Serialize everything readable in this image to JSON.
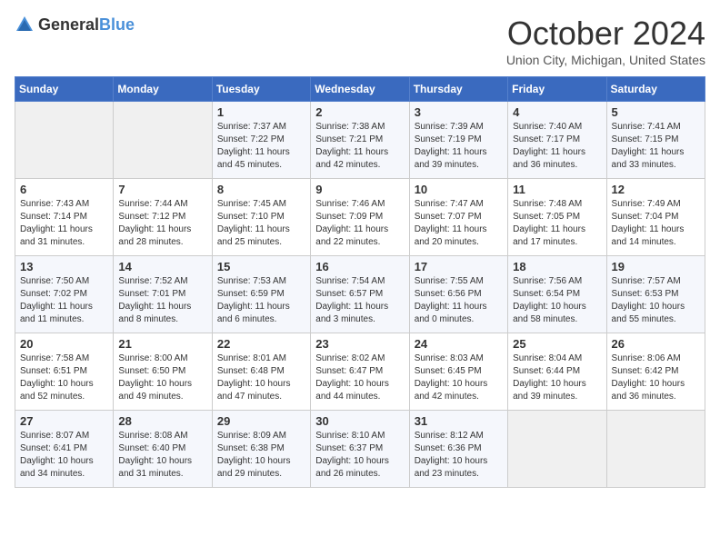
{
  "header": {
    "logo_general": "General",
    "logo_blue": "Blue",
    "title": "October 2024",
    "location": "Union City, Michigan, United States"
  },
  "days_of_week": [
    "Sunday",
    "Monday",
    "Tuesday",
    "Wednesday",
    "Thursday",
    "Friday",
    "Saturday"
  ],
  "weeks": [
    [
      {
        "day": "",
        "sunrise": "",
        "sunset": "",
        "daylight": "",
        "empty": true
      },
      {
        "day": "",
        "sunrise": "",
        "sunset": "",
        "daylight": "",
        "empty": true
      },
      {
        "day": "1",
        "sunrise": "Sunrise: 7:37 AM",
        "sunset": "Sunset: 7:22 PM",
        "daylight": "Daylight: 11 hours and 45 minutes."
      },
      {
        "day": "2",
        "sunrise": "Sunrise: 7:38 AM",
        "sunset": "Sunset: 7:21 PM",
        "daylight": "Daylight: 11 hours and 42 minutes."
      },
      {
        "day": "3",
        "sunrise": "Sunrise: 7:39 AM",
        "sunset": "Sunset: 7:19 PM",
        "daylight": "Daylight: 11 hours and 39 minutes."
      },
      {
        "day": "4",
        "sunrise": "Sunrise: 7:40 AM",
        "sunset": "Sunset: 7:17 PM",
        "daylight": "Daylight: 11 hours and 36 minutes."
      },
      {
        "day": "5",
        "sunrise": "Sunrise: 7:41 AM",
        "sunset": "Sunset: 7:15 PM",
        "daylight": "Daylight: 11 hours and 33 minutes."
      }
    ],
    [
      {
        "day": "6",
        "sunrise": "Sunrise: 7:43 AM",
        "sunset": "Sunset: 7:14 PM",
        "daylight": "Daylight: 11 hours and 31 minutes."
      },
      {
        "day": "7",
        "sunrise": "Sunrise: 7:44 AM",
        "sunset": "Sunset: 7:12 PM",
        "daylight": "Daylight: 11 hours and 28 minutes."
      },
      {
        "day": "8",
        "sunrise": "Sunrise: 7:45 AM",
        "sunset": "Sunset: 7:10 PM",
        "daylight": "Daylight: 11 hours and 25 minutes."
      },
      {
        "day": "9",
        "sunrise": "Sunrise: 7:46 AM",
        "sunset": "Sunset: 7:09 PM",
        "daylight": "Daylight: 11 hours and 22 minutes."
      },
      {
        "day": "10",
        "sunrise": "Sunrise: 7:47 AM",
        "sunset": "Sunset: 7:07 PM",
        "daylight": "Daylight: 11 hours and 20 minutes."
      },
      {
        "day": "11",
        "sunrise": "Sunrise: 7:48 AM",
        "sunset": "Sunset: 7:05 PM",
        "daylight": "Daylight: 11 hours and 17 minutes."
      },
      {
        "day": "12",
        "sunrise": "Sunrise: 7:49 AM",
        "sunset": "Sunset: 7:04 PM",
        "daylight": "Daylight: 11 hours and 14 minutes."
      }
    ],
    [
      {
        "day": "13",
        "sunrise": "Sunrise: 7:50 AM",
        "sunset": "Sunset: 7:02 PM",
        "daylight": "Daylight: 11 hours and 11 minutes."
      },
      {
        "day": "14",
        "sunrise": "Sunrise: 7:52 AM",
        "sunset": "Sunset: 7:01 PM",
        "daylight": "Daylight: 11 hours and 8 minutes."
      },
      {
        "day": "15",
        "sunrise": "Sunrise: 7:53 AM",
        "sunset": "Sunset: 6:59 PM",
        "daylight": "Daylight: 11 hours and 6 minutes."
      },
      {
        "day": "16",
        "sunrise": "Sunrise: 7:54 AM",
        "sunset": "Sunset: 6:57 PM",
        "daylight": "Daylight: 11 hours and 3 minutes."
      },
      {
        "day": "17",
        "sunrise": "Sunrise: 7:55 AM",
        "sunset": "Sunset: 6:56 PM",
        "daylight": "Daylight: 11 hours and 0 minutes."
      },
      {
        "day": "18",
        "sunrise": "Sunrise: 7:56 AM",
        "sunset": "Sunset: 6:54 PM",
        "daylight": "Daylight: 10 hours and 58 minutes."
      },
      {
        "day": "19",
        "sunrise": "Sunrise: 7:57 AM",
        "sunset": "Sunset: 6:53 PM",
        "daylight": "Daylight: 10 hours and 55 minutes."
      }
    ],
    [
      {
        "day": "20",
        "sunrise": "Sunrise: 7:58 AM",
        "sunset": "Sunset: 6:51 PM",
        "daylight": "Daylight: 10 hours and 52 minutes."
      },
      {
        "day": "21",
        "sunrise": "Sunrise: 8:00 AM",
        "sunset": "Sunset: 6:50 PM",
        "daylight": "Daylight: 10 hours and 49 minutes."
      },
      {
        "day": "22",
        "sunrise": "Sunrise: 8:01 AM",
        "sunset": "Sunset: 6:48 PM",
        "daylight": "Daylight: 10 hours and 47 minutes."
      },
      {
        "day": "23",
        "sunrise": "Sunrise: 8:02 AM",
        "sunset": "Sunset: 6:47 PM",
        "daylight": "Daylight: 10 hours and 44 minutes."
      },
      {
        "day": "24",
        "sunrise": "Sunrise: 8:03 AM",
        "sunset": "Sunset: 6:45 PM",
        "daylight": "Daylight: 10 hours and 42 minutes."
      },
      {
        "day": "25",
        "sunrise": "Sunrise: 8:04 AM",
        "sunset": "Sunset: 6:44 PM",
        "daylight": "Daylight: 10 hours and 39 minutes."
      },
      {
        "day": "26",
        "sunrise": "Sunrise: 8:06 AM",
        "sunset": "Sunset: 6:42 PM",
        "daylight": "Daylight: 10 hours and 36 minutes."
      }
    ],
    [
      {
        "day": "27",
        "sunrise": "Sunrise: 8:07 AM",
        "sunset": "Sunset: 6:41 PM",
        "daylight": "Daylight: 10 hours and 34 minutes."
      },
      {
        "day": "28",
        "sunrise": "Sunrise: 8:08 AM",
        "sunset": "Sunset: 6:40 PM",
        "daylight": "Daylight: 10 hours and 31 minutes."
      },
      {
        "day": "29",
        "sunrise": "Sunrise: 8:09 AM",
        "sunset": "Sunset: 6:38 PM",
        "daylight": "Daylight: 10 hours and 29 minutes."
      },
      {
        "day": "30",
        "sunrise": "Sunrise: 8:10 AM",
        "sunset": "Sunset: 6:37 PM",
        "daylight": "Daylight: 10 hours and 26 minutes."
      },
      {
        "day": "31",
        "sunrise": "Sunrise: 8:12 AM",
        "sunset": "Sunset: 6:36 PM",
        "daylight": "Daylight: 10 hours and 23 minutes."
      },
      {
        "day": "",
        "sunrise": "",
        "sunset": "",
        "daylight": "",
        "empty": true
      },
      {
        "day": "",
        "sunrise": "",
        "sunset": "",
        "daylight": "",
        "empty": true
      }
    ]
  ]
}
